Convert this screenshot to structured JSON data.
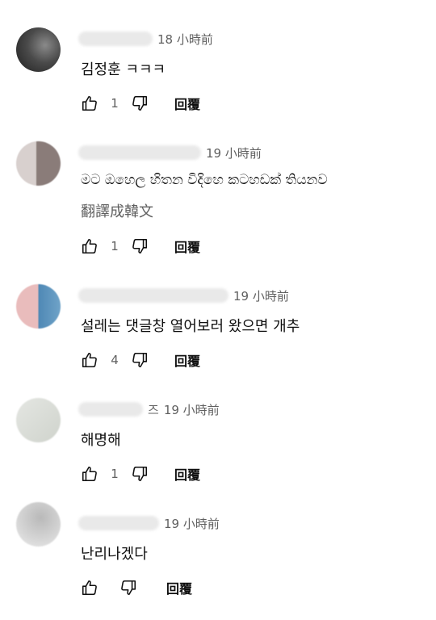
{
  "comments": [
    {
      "time": "18 小時前",
      "text": "김정훈 ㅋㅋㅋ",
      "likes": "1",
      "reply": "回覆",
      "avatar_colors": [
        "#2a2a2a",
        "#777777"
      ]
    },
    {
      "time": "19 小時前",
      "text": "මට ඔහෙල හිතන විදිහෙ කටහඩක් තියනව",
      "translate": "翻譯成韓文",
      "likes": "1",
      "reply": "回覆",
      "avatar_colors": [
        "#cfc6c4",
        "#8c7f7c"
      ]
    },
    {
      "time": "19 小時前",
      "text": "설레는 댓글창 열어보러 왔으면 개추",
      "likes": "4",
      "reply": "回覆",
      "avatar_colors": [
        "#e7b9b9",
        "#5c8fb7"
      ]
    },
    {
      "time": "19 小時前",
      "author_fragment": "즈",
      "text": "해명해",
      "likes": "1",
      "reply": "回覆",
      "avatar_colors": [
        "#d9dcd6",
        "#c8ccc6"
      ]
    },
    {
      "time": "19 小時前",
      "text": "난리나겠다",
      "reply": "回覆",
      "avatar_colors": [
        "#c9c9c9",
        "#e3e3e3"
      ]
    }
  ]
}
